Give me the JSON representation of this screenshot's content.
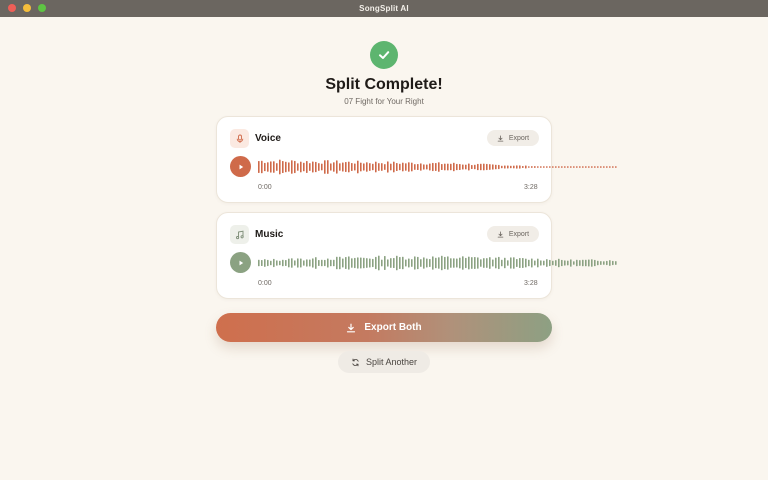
{
  "window": {
    "title": "SongSplit AI"
  },
  "status": {
    "heading": "Split Complete!",
    "song_name": "07 Fight for Your Right"
  },
  "tracks": [
    {
      "label": "Voice",
      "export_label": "Export",
      "start_time": "0:00",
      "end_time": "3:28",
      "color": "#cf6a4a",
      "icon": "microphone-icon"
    },
    {
      "label": "Music",
      "export_label": "Export",
      "start_time": "0:00",
      "end_time": "3:28",
      "color": "#8ba282",
      "icon": "music-note-icon"
    }
  ],
  "actions": {
    "export_both_label": "Export Both",
    "split_another_label": "Split Another"
  },
  "colors": {
    "background": "#faf6ef",
    "success": "#5db56f",
    "voice_accent": "#cf6a4a",
    "music_accent": "#8ba282"
  }
}
